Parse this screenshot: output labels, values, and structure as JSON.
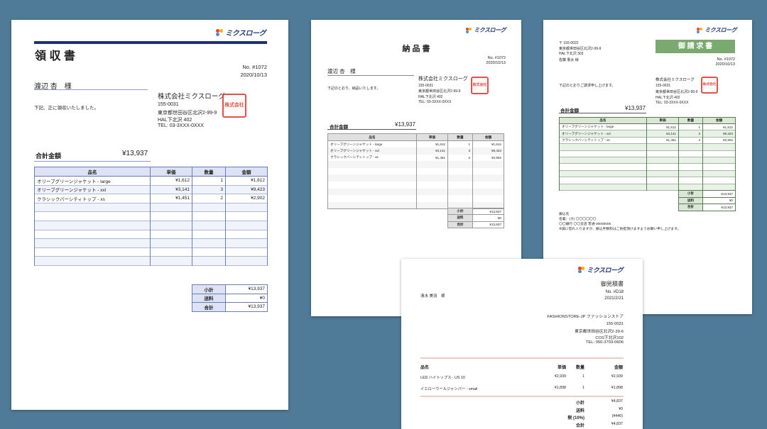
{
  "logo_text": "ミクスローグ",
  "colors": {
    "background": "#4f7b98",
    "receipt_accent": "#1f2f73",
    "receipt_header": "#dde3f4",
    "delivery_header": "#e0e0e0",
    "invoice_green": "#7aaa6f",
    "invoice_header": "#d9e8d5",
    "estimate_pink": "#f4c7c4",
    "stamp_red": "#d9362b"
  },
  "stamp_text": "株式会社ミクスローグ",
  "receipt": {
    "title": "領 収 書",
    "number": "No. #1072",
    "date": "2020/10/13",
    "recipient": "渡辺 杏　様",
    "message": "下記、正に領収いたしました。",
    "company": "株式会社ミクスローグ",
    "postal": "155-0031",
    "address": "東京都世田谷区北沢2-99-9",
    "building": "HAL下北沢 402",
    "tel": "TEL: 03-3XXX-0XXX",
    "total_label": "合計金額",
    "total_value": "¥13,937",
    "headers": [
      "品名",
      "単価",
      "数量",
      "金額"
    ],
    "items": [
      [
        "オリーブグリーンジャケット - large",
        "¥1,612",
        "1",
        "¥1,612"
      ],
      [
        "オリーブグリーンジャケット - xxl",
        "¥3,141",
        "3",
        "¥9,423"
      ],
      [
        "クラシックバーシティトップ - xs",
        "¥1,451",
        "2",
        "¥2,902"
      ]
    ],
    "summary": [
      [
        "小計",
        "¥13,937"
      ],
      [
        "送料",
        "¥0"
      ],
      [
        "合計",
        "¥13,937"
      ]
    ]
  },
  "delivery": {
    "title": "納 品 書",
    "number": "No. #1072",
    "date": "2020/10/13",
    "recipient": "渡辺 杏　様",
    "message": "下記のとおり、納品いたします。",
    "company": "株式会社ミクスローグ",
    "postal": "155-0031",
    "address": "東京都世田谷区北沢2-99-9",
    "building": "HAL下北沢 402",
    "tel": "TEL: 03-3XXX-0XXX",
    "total_label": "合計金額",
    "total_value": "¥13,937",
    "headers": [
      "品名",
      "単価",
      "数量",
      "金額"
    ],
    "items": [
      [
        "オリーブグリーンジャケット - large",
        "¥1,612",
        "1",
        "¥1,612"
      ],
      [
        "オリーブグリーンジャケット - xxl",
        "¥3,141",
        "3",
        "¥9,423"
      ],
      [
        "クラシックバーシティトップ - xs",
        "¥1,451",
        "2",
        "¥2,902"
      ]
    ],
    "summary": [
      [
        "小計",
        "¥13,937"
      ],
      [
        "送料",
        "¥0"
      ],
      [
        "合計",
        "¥13,937"
      ]
    ]
  },
  "invoice": {
    "title": "御 請 求 書",
    "to_postal": "〒 155-0022",
    "to_address": "東京都世田谷区北沢2-99-9",
    "to_building": "HAL下北沢 303",
    "to_name": "佐藤 憲太 様",
    "number": "No. #1072",
    "date": "2020/10/13",
    "message": "下記のとおりご請求申し上げます。",
    "company": "株式会社ミクスローグ",
    "postal": "155-0031",
    "address": "東京都世田谷区北沢2-99-9",
    "building": "HAL下北沢 402",
    "tel": "TEL: 03-3XXX-0XXX",
    "total_label": "合計金額",
    "total_value": "¥13,937",
    "headers": [
      "品名",
      "単価",
      "数量",
      "金額"
    ],
    "items": [
      [
        "オリーブグリーンジャケット - large",
        "¥1,612",
        "1",
        "¥1,612"
      ],
      [
        "オリーブグリーンジャケット - xxl",
        "¥3,141",
        "3",
        "¥9,423"
      ],
      [
        "クラシックバーシティトップ - xs",
        "¥1,451",
        "2",
        "¥2,902"
      ]
    ],
    "summary": [
      [
        "小計",
        "¥13,937"
      ],
      [
        "送料",
        "¥0"
      ],
      [
        "合計",
        "¥13,937"
      ]
    ],
    "bank_label": "振込先",
    "bank_name": "名義：(カ) 〇〇〇〇〇〇",
    "bank_branch": "〇〇銀行 〇〇支店 普通 00000000",
    "bank_note": "※誠に恐れ入りますが、振込手数料はご負担頂けますようお願い申し上げます。"
  },
  "estimate": {
    "title": "御見積書",
    "number": "No. #D18",
    "date": "2021/2/21",
    "recipient": "清水 美羽　様",
    "shop": "FASHIONSTORE-JP ファッションストア",
    "postal": "155-0031",
    "address": "東京都世田谷区北沢2-39-6",
    "building": "COS下北沢102",
    "tel": "TEL: 050-3703-0606",
    "headers": [
      "品名",
      "単価",
      "数量",
      "金額"
    ],
    "items": [
      [
        "LED ハイトップス - US 10",
        "¥2,939",
        "1",
        "¥2,939"
      ],
      [
        "イエローウールジャンパー - small",
        "¥1,898",
        "1",
        "¥1,898"
      ]
    ],
    "summary": [
      [
        "小計",
        "¥4,837"
      ],
      [
        "送料",
        "¥0"
      ],
      [
        "税 (10%)",
        "(¥440)"
      ],
      [
        "合計",
        "¥4,837"
      ]
    ]
  }
}
